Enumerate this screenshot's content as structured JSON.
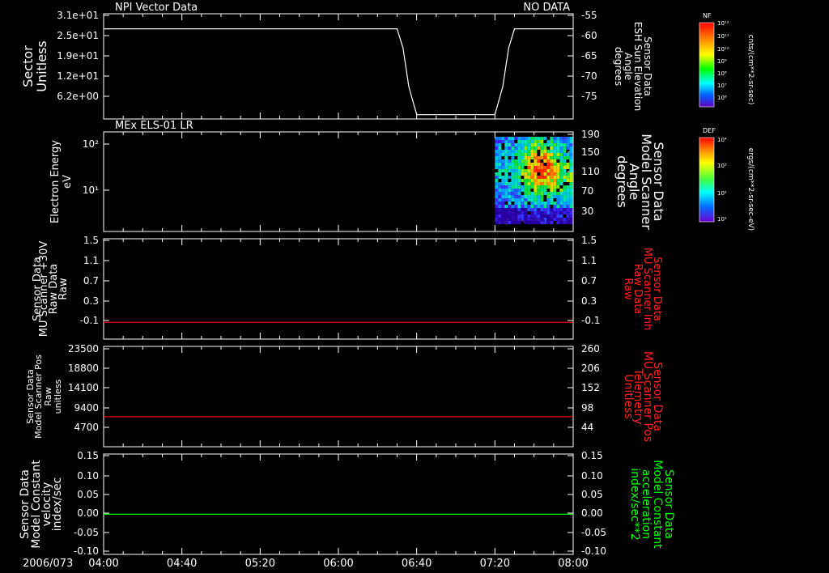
{
  "header": {
    "title": "NPI Vector Data",
    "status": "NO DATA"
  },
  "colorbars": [
    {
      "label": "NF",
      "ticks": [
        "10¹²",
        "10¹¹",
        "10¹⁰",
        "10⁹",
        "10⁸",
        "10⁷",
        "10⁶"
      ],
      "unit": "cnts/(cm**2-sr-sec)"
    },
    {
      "label": "DEF",
      "ticks": [
        "10⁴",
        "10³",
        "10²",
        "10¹"
      ],
      "unit": "ergs/(cm**2-sr-sec-eV)"
    }
  ],
  "chart_data": [
    {
      "type": "line",
      "title": "NPI Vector Data",
      "ylabel": [
        "Sector",
        "Unitless"
      ],
      "ylabel_right": [
        "Sensor Data",
        "ESH Sun Elevation",
        "Angle",
        "degrees"
      ],
      "yticks_left": [
        "3.1e+01",
        "2.5e+01",
        "1.9e+01",
        "1.2e+01",
        "6.2e+00"
      ],
      "yticks_right": [
        "-55",
        "-60",
        "-65",
        "-70",
        "-75"
      ],
      "ylim_right": [
        -79.5,
        -55
      ],
      "series": [
        {
          "axis": "right",
          "color": "#ffffff",
          "x": [
            "04:00",
            "06:30",
            "06:33",
            "06:36",
            "06:40",
            "07:20",
            "07:24",
            "07:27",
            "07:30",
            "08:00"
          ],
          "y": [
            -58.5,
            -58.5,
            -63,
            -72,
            -78.5,
            -78.5,
            -72,
            -63,
            -58.5,
            -58.5
          ]
        }
      ]
    },
    {
      "type": "heatmap",
      "title": "MEx ELS-01 LR",
      "ylabel": [
        "Electron Energy",
        "eV"
      ],
      "ylabel_right": [
        "Sensor Data",
        "Model Scanner",
        "Angle",
        "degrees"
      ],
      "yticks_left": [
        "10²",
        "10¹"
      ],
      "yticks_right": [
        "190",
        "150",
        "110",
        "70",
        "30"
      ],
      "ylim_right": [
        0,
        190
      ],
      "data_start": "07:20",
      "data_end": "08:00",
      "peak_time": "07:42",
      "peak_angle": 130
    },
    {
      "type": "line",
      "ylabel": [
        "Sensor Data",
        "MU Scanner +30V",
        "Raw Data",
        "Raw"
      ],
      "ylabel_right": [
        "Sensor Data",
        "MU Scanner Inh",
        "Raw Data",
        "Raw"
      ],
      "yticks_left": [
        "1.5",
        "1.1",
        "0.7",
        "0.3",
        "-0.1"
      ],
      "yticks_right": [
        "1.5",
        "1.1",
        "0.7",
        "0.3",
        "-0.1"
      ],
      "ylim": [
        -0.3,
        1.5
      ],
      "series": [
        {
          "axis": "right",
          "color": "#ff0000",
          "x": [
            "04:00",
            "08:00"
          ],
          "y": [
            0,
            0
          ]
        }
      ]
    },
    {
      "type": "line",
      "ylabel": [
        "Sensor Data",
        "Model Scanner Pos",
        "Raw",
        "unitless"
      ],
      "ylabel_right": [
        "Sensor Data",
        "MU Scanner Pos",
        "Telemetry",
        "Unitless"
      ],
      "yticks_left": [
        "23500",
        "18800",
        "14100",
        "9400",
        "4700"
      ],
      "yticks_right": [
        "260",
        "206",
        "152",
        "98",
        "44"
      ],
      "ylim_right": [
        0,
        260
      ],
      "series": [
        {
          "axis": "right",
          "color": "#ff0000",
          "x": [
            "04:00",
            "08:00"
          ],
          "y": [
            78,
            78
          ]
        }
      ]
    },
    {
      "type": "line",
      "ylabel": [
        "Sensor Data",
        "Model Constant",
        "velocity",
        "index/sec"
      ],
      "ylabel_right": [
        "Sensor Data",
        "Model Constant",
        "acceleration",
        "index/sec**2"
      ],
      "yticks_left": [
        "0.15",
        "0.10",
        "0.05",
        "0.00",
        "-0.05",
        "-0.10"
      ],
      "yticks_right": [
        "0.15",
        "0.10",
        "0.05",
        "0.00",
        "-0.05",
        "-0.10"
      ],
      "ylim": [
        -0.1,
        0.15
      ],
      "series": [
        {
          "axis": "right",
          "color": "#00ff00",
          "x": [
            "04:00",
            "08:00"
          ],
          "y": [
            0,
            0
          ]
        }
      ]
    }
  ],
  "xaxis": {
    "date": "2006/073",
    "ticks": [
      "04:00",
      "04:40",
      "05:20",
      "06:00",
      "06:40",
      "07:20",
      "08:00"
    ],
    "range": [
      "04:00",
      "08:00"
    ]
  }
}
